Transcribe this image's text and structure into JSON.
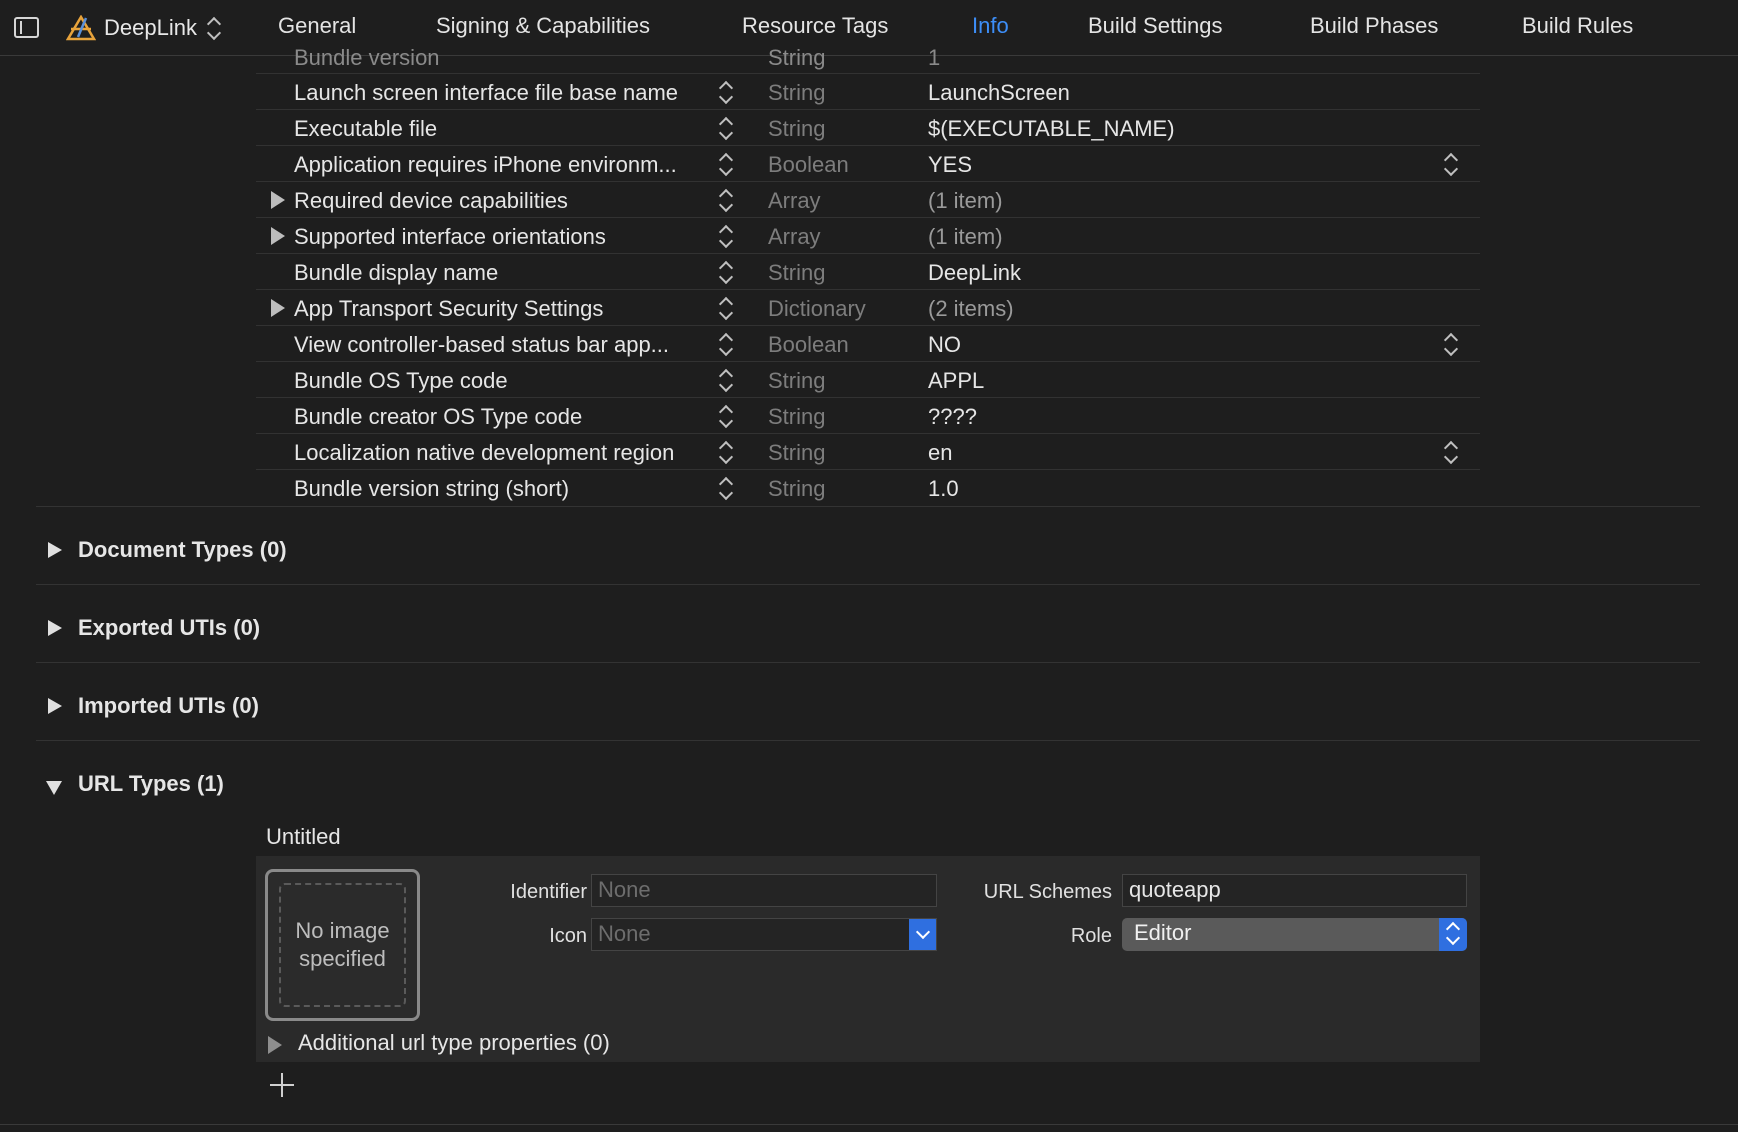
{
  "toolbar": {
    "target_name": "DeepLink",
    "tabs": [
      {
        "label": "General"
      },
      {
        "label": "Signing & Capabilities"
      },
      {
        "label": "Resource Tags"
      },
      {
        "label": "Info"
      },
      {
        "label": "Build Settings"
      },
      {
        "label": "Build Phases"
      },
      {
        "label": "Build Rules"
      }
    ],
    "active_tab": "Info",
    "accent_color": "#3d8ef7"
  },
  "plist": {
    "rows": [
      {
        "key": "Bundle version",
        "type": "String",
        "value": "1"
      },
      {
        "key": "Launch screen interface file base name",
        "type": "String",
        "value": "LaunchScreen"
      },
      {
        "key": "Executable file",
        "type": "String",
        "value": "$(EXECUTABLE_NAME)"
      },
      {
        "key": "Application requires iPhone environm...",
        "type": "Boolean",
        "value": "YES"
      },
      {
        "key": "Required device capabilities",
        "type": "Array",
        "value": "(1 item)"
      },
      {
        "key": "Supported interface orientations",
        "type": "Array",
        "value": "(1 item)"
      },
      {
        "key": "Bundle display name",
        "type": "String",
        "value": "DeepLink"
      },
      {
        "key": "App Transport Security Settings",
        "type": "Dictionary",
        "value": "(2 items)"
      },
      {
        "key": "View controller-based status bar app...",
        "type": "Boolean",
        "value": "NO"
      },
      {
        "key": "Bundle OS Type code",
        "type": "String",
        "value": "APPL"
      },
      {
        "key": "Bundle creator OS Type code",
        "type": "String",
        "value": "????"
      },
      {
        "key": "Localization native development region",
        "type": "String",
        "value": "en"
      },
      {
        "key": "Bundle version string (short)",
        "type": "String",
        "value": "1.0"
      }
    ]
  },
  "sections": [
    {
      "title": "Document Types (0)"
    },
    {
      "title": "Exported UTIs (0)"
    },
    {
      "title": "Imported UTIs (0)"
    },
    {
      "title": "URL Types (1)"
    }
  ],
  "url_type": {
    "title": "Untitled",
    "no_image_text": "No image specified",
    "identifier_label": "Identifier",
    "identifier_placeholder": "None",
    "icon_label": "Icon",
    "icon_placeholder": "None",
    "url_schemes_label": "URL Schemes",
    "url_schemes_value": "quoteapp",
    "role_label": "Role",
    "role_value": "Editor",
    "additional_label": "Additional url type properties (0)"
  }
}
